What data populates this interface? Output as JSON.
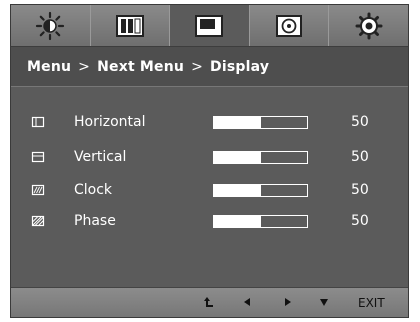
{
  "tabs": [
    {
      "icon": "brightness-icon"
    },
    {
      "icon": "contrast-icon"
    },
    {
      "icon": "display-icon",
      "active": true
    },
    {
      "icon": "disc-icon"
    },
    {
      "icon": "settings-gear-icon"
    }
  ],
  "breadcrumb": {
    "menu": "Menu",
    "sep1": ">",
    "next_menu": "Next Menu",
    "sep2": ">",
    "current": "Display"
  },
  "settings": [
    {
      "label": "Horizontal",
      "value": "50",
      "level": 0.5,
      "icon": "horizontal-position-icon"
    },
    {
      "label": "Vertical",
      "value": "50",
      "level": 0.5,
      "icon": "vertical-position-icon"
    },
    {
      "label": "Clock",
      "value": "50",
      "level": 0.5,
      "icon": "clock-icon"
    },
    {
      "label": "Phase",
      "value": "50",
      "level": 0.5,
      "icon": "phase-icon"
    }
  ],
  "footer": {
    "exit_label": "EXIT"
  },
  "colors": {
    "panel": "#5b5b5b",
    "tab_bar": "#7d7d7d",
    "bar_fill": "#ffffff"
  }
}
